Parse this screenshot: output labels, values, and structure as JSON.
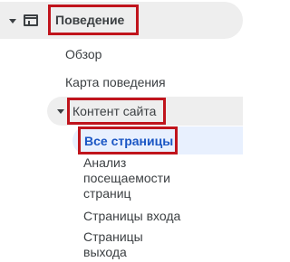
{
  "nav": {
    "section": {
      "label": "Поведение",
      "icon": "report-icon"
    },
    "items": [
      {
        "label": "Обзор"
      },
      {
        "label": "Карта поведения"
      }
    ],
    "subsection": {
      "label": "Контент сайта",
      "items": [
        {
          "label": "Все страницы",
          "active": true
        },
        {
          "label_lines": [
            "Анализ",
            "посещаемости",
            "страниц"
          ]
        },
        {
          "label": "Страницы входа"
        },
        {
          "label_lines": [
            "Страницы",
            "выхода"
          ]
        }
      ]
    }
  },
  "colors": {
    "highlight_box": "#c0141c",
    "active_text": "#1a56c4",
    "active_background": "#e8f0fe",
    "section_background": "#eeeeee",
    "text": "#3c4043"
  }
}
